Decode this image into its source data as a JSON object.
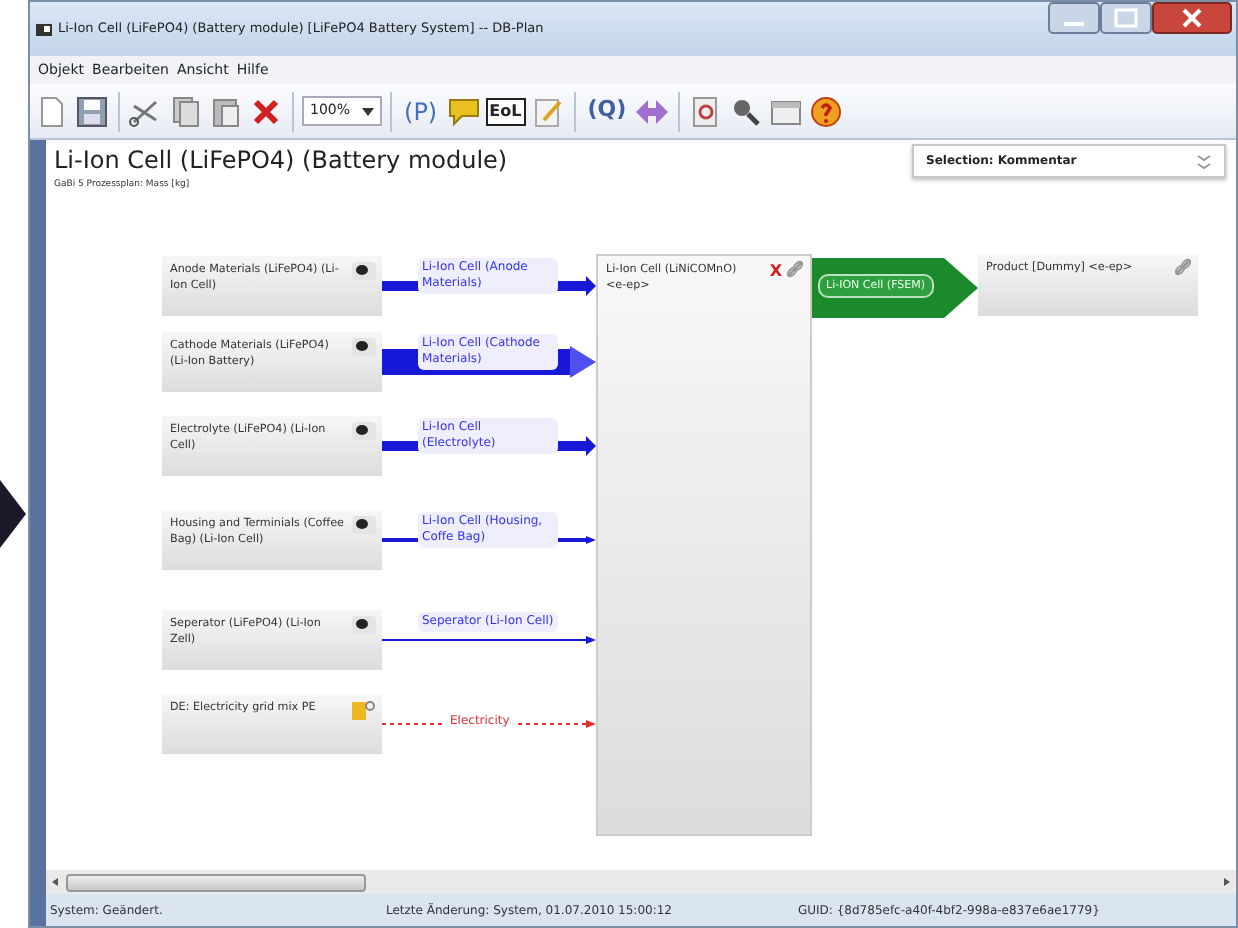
{
  "window": {
    "title": "Li-Ion Cell (LiFePO4) (Battery module) [LiFePO4 Battery System] -- DB-Plan"
  },
  "menu": [
    "Objekt",
    "Bearbeiten",
    "Ansicht",
    "Hilfe"
  ],
  "toolbar": {
    "zoom": "100%",
    "p_label": "(P)",
    "eol_label": "EoL",
    "q_label": "(Q)"
  },
  "header": {
    "title": "Li-Ion Cell (LiFePO4) (Battery module)",
    "subtitle": "GaBi 5 Prozessplan: Mass [kg]"
  },
  "selection_panel": {
    "label": "Selection: Kommentar"
  },
  "diagram": {
    "inputs": [
      {
        "label": "Anode Materials (LiFePO4) (Li-Ion Cell)",
        "flow": "Li-Ion Cell (Anode Materials)",
        "kind": "thick"
      },
      {
        "label": "Cathode Materials (LiFePO4) (Li-Ion Battery)",
        "flow": "Li-Ion Cell (Cathode Materials)",
        "kind": "heavy"
      },
      {
        "label": "Electrolyte (LiFePO4) (Li-Ion Cell)",
        "flow": "Li-Ion Cell (Electrolyte)",
        "kind": "thick"
      },
      {
        "label": "Housing and Terminials (Coffee Bag) (Li-Ion Cell)",
        "flow": "Li-Ion Cell (Housing, Coffe Bag)",
        "kind": "medium"
      },
      {
        "label": "Seperator (LiFePO4) (Li-Ion Zell)",
        "flow": "Seperator (Li-Ion Cell)",
        "kind": "thin"
      },
      {
        "label": "DE: Electricity grid mix PE",
        "flow": "Electricity",
        "kind": "energy"
      }
    ],
    "process": {
      "label": "Li-Ion Cell (LiNiCOMnO)",
      "sublabel": "<e-ep>",
      "mark": "X"
    },
    "output_flow": "Li-ION Cell (FSEM)",
    "product": {
      "label": "Product [Dummy] <e-ep>"
    }
  },
  "status_bar": [
    "System: Geändert.",
    "Letzte Änderung: System, 01.07.2010 15:00:12",
    "GUID: {8d785efc-a40f-4bf2-998a-e837e6ae1779}"
  ]
}
